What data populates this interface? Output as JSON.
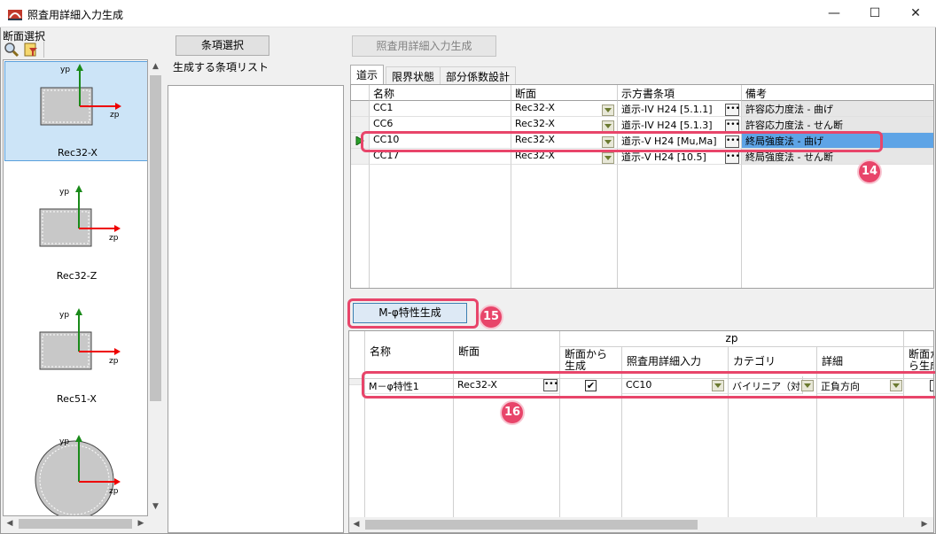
{
  "window": {
    "title": "照査用詳細入力生成",
    "controls": [
      "—",
      "☐",
      "✕"
    ]
  },
  "left": {
    "label": "断面選択",
    "thumbs": [
      {
        "name": "Rec32-X",
        "axis_y": "yp",
        "axis_z": "zp"
      },
      {
        "name": "Rec32-Z",
        "axis_y": "yp",
        "axis_z": "zp"
      },
      {
        "name": "Rec51-X",
        "axis_y": "yp",
        "axis_z": "zp"
      },
      {
        "name": "",
        "axis_y": "yp",
        "axis_z": "zp"
      }
    ]
  },
  "middle": {
    "select_button": "条項選択",
    "list_label": "生成する条項リスト"
  },
  "right": {
    "generate_button": "照査用詳細入力生成",
    "tabs": [
      "道示",
      "限界状態",
      "部分係数設計"
    ],
    "grid1": {
      "headers": [
        "名称",
        "断面",
        "示方書条項",
        "備考"
      ],
      "rows": [
        {
          "name": "CC1",
          "section": "Rec32-X",
          "clause": "道示-IV H24 [5.1.1]",
          "note": "許容応力度法 - 曲げ"
        },
        {
          "name": "CC6",
          "section": "Rec32-X",
          "clause": "道示-IV H24 [5.1.3]",
          "note": "許容応力度法 - せん断"
        },
        {
          "name": "CC10",
          "section": "Rec32-X",
          "clause": "道示-V H24 [Mu,Ma]",
          "note": "終局強度法 - 曲げ"
        },
        {
          "name": "CC17",
          "section": "Rec32-X",
          "clause": "道示-V H24 [10.5]",
          "note": "終局強度法 - せん断"
        }
      ]
    },
    "mphi_button": "M-φ特性生成",
    "grid2": {
      "group_header": "zp",
      "headers": [
        "名称",
        "断面",
        "断面から生成",
        "照査用詳細入力",
        "カテゴリ",
        "詳細",
        "断面から生成"
      ],
      "row": {
        "name": "M－φ特性1",
        "section": "Rec32-X",
        "checked": "✔",
        "detail_input": "CC10",
        "category": "バイリニア（対",
        "detail": "正負方向"
      }
    },
    "callouts": [
      "14",
      "15",
      "16"
    ]
  },
  "colors": {
    "accent": "#e8456a",
    "selected": "#cce4f7",
    "row_highlight": "#5ea4e6"
  }
}
